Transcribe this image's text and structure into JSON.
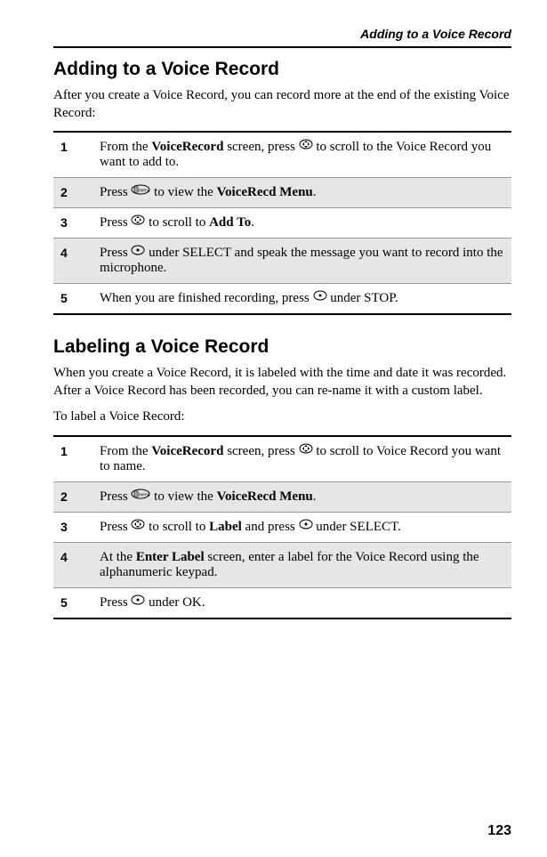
{
  "header": "Adding to a Voice Record",
  "section1": {
    "title": "Adding to a Voice Record",
    "intro": "After you create a Voice Record, you can record more at the end of the existing Voice Record:",
    "steps": [
      {
        "num": "1",
        "pre": "From the ",
        "b1": "VoiceRecord",
        "mid": " screen, press ",
        "icon": "dpad",
        "post": " to scroll to the Voice Record you want to add to."
      },
      {
        "num": "2",
        "pre": "Press ",
        "icon": "menu",
        "mid": " to view the ",
        "b1": "VoiceRecd Menu",
        "post": "."
      },
      {
        "num": "3",
        "pre": "Press ",
        "icon": "dpad",
        "mid": " to scroll to ",
        "b1": "Add To",
        "post": "."
      },
      {
        "num": "4",
        "pre": "Press ",
        "icon": "dot",
        "mid": " under SELECT and speak the message you want to record into the microphone.",
        "b1": "",
        "post": ""
      },
      {
        "num": "5",
        "pre": "When you are finished recording, press ",
        "icon": "dot",
        "mid": " under STOP.",
        "b1": "",
        "post": ""
      }
    ]
  },
  "section2": {
    "title": "Labeling a Voice Record",
    "intro": "When you create a Voice Record, it is labeled with the time and date it was recorded. After a Voice Record has been recorded, you can re-name it with a custom label.",
    "lead": "To label a Voice Record:",
    "steps": [
      {
        "num": "1",
        "pre": "From the ",
        "b1": "VoiceRecord",
        "mid": " screen, press ",
        "icon": "dpad",
        "post": " to scroll to Voice Record you want to name."
      },
      {
        "num": "2",
        "pre": "Press ",
        "icon": "menu",
        "mid": " to view the ",
        "b1": "VoiceRecd Menu",
        "post": "."
      },
      {
        "num": "3",
        "pre": "Press ",
        "icon": "dpad",
        "mid": " to scroll to ",
        "b1": "Label",
        "mid2": " and press ",
        "icon2": "dot",
        "post": " under SELECT."
      },
      {
        "num": "4",
        "pre": "At the ",
        "b1": "Enter Label",
        "mid": " screen, enter a label for the Voice Record using the alphanumeric keypad.",
        "post": ""
      },
      {
        "num": "5",
        "pre": "Press ",
        "icon": "dot",
        "mid": " under OK.",
        "b1": "",
        "post": ""
      }
    ]
  },
  "pageNumber": "123"
}
